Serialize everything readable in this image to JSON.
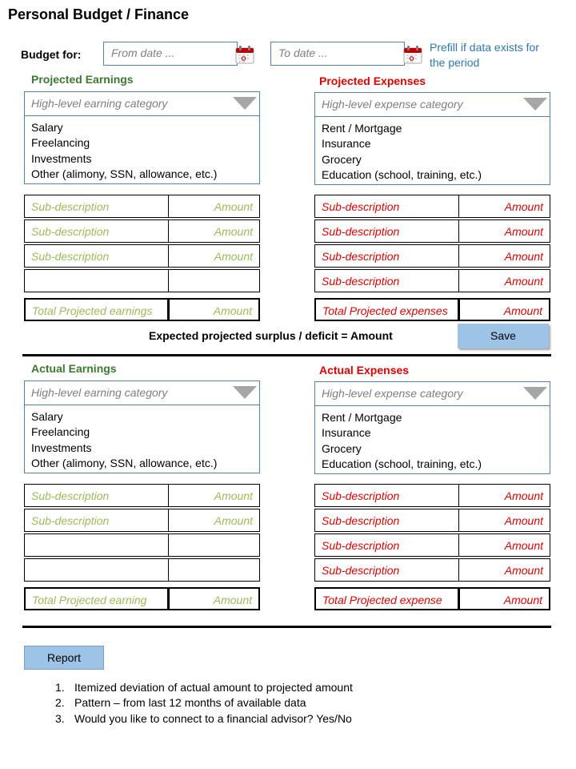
{
  "title": "Personal Budget / Finance",
  "budget_for": {
    "label": "Budget for:",
    "from_placeholder": "From date ...",
    "to_placeholder": "To date ...",
    "prefill_note_line1": "Prefill if data exists for",
    "prefill_note_line2": "the period"
  },
  "projected": {
    "earnings_heading": "Projected Earnings",
    "expenses_heading": "Projected Expenses",
    "earning_dropdown": {
      "placeholder": "High-level  earning category",
      "options": [
        "Salary",
        "Freelancing",
        "Investments",
        "Other (alimony, SSN,  allowance, etc.)"
      ]
    },
    "expense_dropdown": {
      "placeholder": "High-level  expense category",
      "options": [
        "Rent / Mortgage",
        "Insurance",
        "Grocery",
        "Education (school, training, etc.)"
      ]
    },
    "earning_rows": [
      {
        "desc": "Sub-description",
        "amount": "Amount"
      },
      {
        "desc": "Sub-description",
        "amount": "Amount"
      },
      {
        "desc": "Sub-description",
        "amount": "Amount"
      },
      {
        "desc": "",
        "amount": ""
      }
    ],
    "expense_rows": [
      {
        "desc": "Sub-description",
        "amount": "Amount"
      },
      {
        "desc": "Sub-description",
        "amount": "Amount"
      },
      {
        "desc": "Sub-description",
        "amount": "Amount"
      },
      {
        "desc": "Sub-description",
        "amount": "Amount"
      }
    ],
    "earning_total": {
      "desc": "Total Projected earnings",
      "amount": "Amount"
    },
    "expense_total": {
      "desc": "Total Projected expenses",
      "amount": "Amount"
    },
    "surplus_text": "Expected projected surplus / deficit  =  Amount",
    "save_label": "Save"
  },
  "actual": {
    "earnings_heading": "Actual Earnings",
    "expenses_heading": "Actual Expenses",
    "earning_dropdown": {
      "placeholder": "High-level  earning category",
      "options": [
        "Salary",
        "Freelancing",
        "Investments",
        "Other (alimony, SSN,  allowance, etc.)"
      ]
    },
    "expense_dropdown": {
      "placeholder": "High-level  expense category",
      "options": [
        "Rent / Mortgage",
        "Insurance",
        "Grocery",
        "Education (school, training, etc.)"
      ]
    },
    "earning_rows": [
      {
        "desc": "Sub-description",
        "amount": "Amount"
      },
      {
        "desc": "Sub-description",
        "amount": "Amount"
      },
      {
        "desc": "",
        "amount": ""
      },
      {
        "desc": "",
        "amount": ""
      }
    ],
    "expense_rows": [
      {
        "desc": "Sub-description",
        "amount": "Amount"
      },
      {
        "desc": "Sub-description",
        "amount": "Amount"
      },
      {
        "desc": "Sub-description",
        "amount": "Amount"
      },
      {
        "desc": "Sub-description",
        "amount": "Amount"
      }
    ],
    "earning_total": {
      "desc": "Total Projected earning",
      "amount": "Amount"
    },
    "expense_total": {
      "desc": "Total Projected expense",
      "amount": "Amount"
    }
  },
  "report": {
    "button_label": "Report",
    "items": [
      {
        "num": "1.",
        "text": "Itemized deviation of actual amount to projected amount"
      },
      {
        "num": "2.",
        "text": "Pattern – from last 12 months  of available data"
      },
      {
        "num": "3.",
        "text": "Would you like to connect to a financial advisor? Yes/No"
      }
    ]
  },
  "colors": {
    "green_heading": "#3b7a2e",
    "green_placeholder": "#9bbb59",
    "red": "#e00000",
    "blue_border": "#4f81bd",
    "button_fill": "#9dc3e6"
  },
  "icons": [
    "calendar-icon",
    "chevron-down-icon"
  ]
}
